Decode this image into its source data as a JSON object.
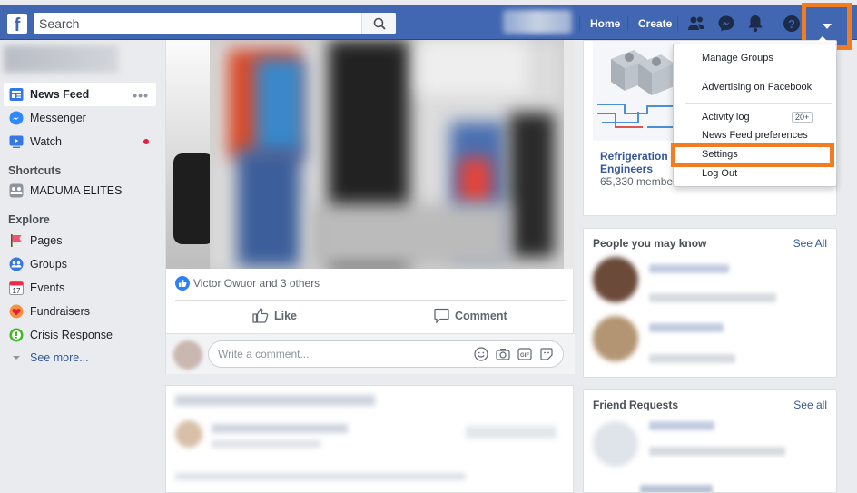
{
  "topbar": {
    "logo": "f",
    "search_placeholder": "Search",
    "nav": {
      "home": "Home",
      "create": "Create"
    },
    "icons": [
      "friends-icon",
      "messenger-icon",
      "notifications-icon",
      "help-icon",
      "account-menu-caret-icon"
    ]
  },
  "left_nav": {
    "items": [
      {
        "label": "News Feed",
        "icon": "news-feed-icon",
        "more": "•••"
      },
      {
        "label": "Messenger",
        "icon": "messenger-icon"
      },
      {
        "label": "Watch",
        "icon": "watch-icon"
      }
    ],
    "shortcuts_heading": "Shortcuts",
    "shortcuts": [
      {
        "label": "MADUMA ELITES",
        "icon": "group-icon"
      }
    ],
    "explore_heading": "Explore",
    "explore": [
      {
        "label": "Pages",
        "icon": "pages-flag-icon"
      },
      {
        "label": "Groups",
        "icon": "groups-icon"
      },
      {
        "label": "Events",
        "icon": "events-calendar-icon",
        "icon_text": "17"
      },
      {
        "label": "Fundraisers",
        "icon": "fundraisers-icon"
      },
      {
        "label": "Crisis Response",
        "icon": "crisis-response-icon"
      }
    ],
    "see_more": "See more..."
  },
  "post": {
    "reactions_text": "Victor Owuor and 3 others",
    "like_label": "Like",
    "comment_label": "Comment",
    "comment_placeholder": "Write a comment...",
    "comment_tools": [
      "emoji-icon",
      "camera-icon",
      "gif-icon",
      "sticker-icon"
    ]
  },
  "right_col": {
    "group_suggestion": {
      "name_line1": "Refrigeration O",
      "name_line2": "Engineers",
      "members": "65,330 member"
    },
    "people_title": "People you may know",
    "people_link": "See All",
    "friend_requests_title": "Friend Requests",
    "friend_requests_link": "See all"
  },
  "dropdown": {
    "items": [
      {
        "label": "Manage Groups"
      },
      {
        "label": "Advertising on Facebook"
      },
      {
        "label": "Activity log",
        "badge": "20+"
      },
      {
        "label": "News Feed preferences"
      },
      {
        "label": "Settings"
      },
      {
        "label": "Log Out"
      }
    ]
  },
  "colors": {
    "brand": "#4267b2",
    "highlight": "#f47c20",
    "link": "#365899"
  }
}
